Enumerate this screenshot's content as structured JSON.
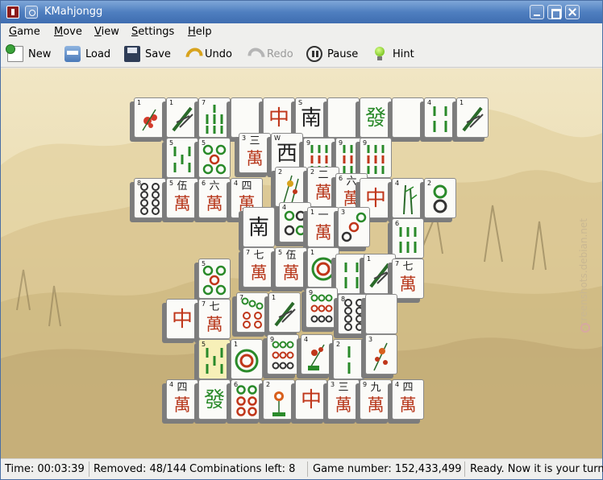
{
  "window": {
    "title": "KMahjongg"
  },
  "menu": {
    "items": [
      "Game",
      "Move",
      "View",
      "Settings",
      "Help"
    ]
  },
  "toolbar": {
    "new_label": "New",
    "load_label": "Load",
    "save_label": "Save",
    "undo_label": "Undo",
    "redo_label": "Redo",
    "pause_label": "Pause",
    "hint_label": "Hint",
    "redo_enabled": false
  },
  "board": {
    "watermark": "screenshots.debian.net"
  },
  "status": {
    "time": "Time: 00:03:39",
    "removed": "Removed: 48/144",
    "combinations": "Combinations left: 8",
    "game_number": "Game number: 152,433,499",
    "message": "Ready. Now it is your turn."
  },
  "tile_symbols": {
    "red_dragon": "中",
    "green_dragon": "發",
    "south_wind": "南",
    "west_wind": "西",
    "wan": "萬",
    "one": "一",
    "two": "二",
    "three": "三",
    "four": "四",
    "five": "伍",
    "six": "六",
    "seven": "七",
    "nine": "九",
    "south_index": "S",
    "west_index": "W"
  },
  "colors": {
    "titlebar": "#4f7fc0",
    "dragon_red": "#c0361a",
    "dragon_green": "#2a8a2a",
    "tile_face": "#fbfbf8",
    "board_bg": "#eadcb1"
  }
}
